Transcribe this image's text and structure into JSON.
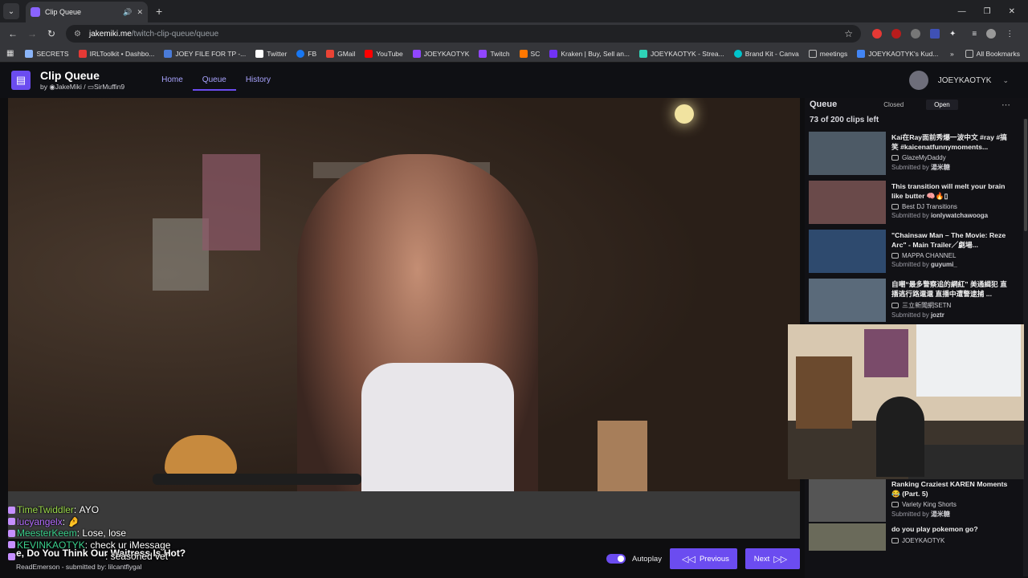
{
  "browser": {
    "tab_title": "Clip Queue",
    "url_host": "jakemiki.me",
    "url_path": "/twitch-clip-queue/queue",
    "bookmarks": [
      {
        "label": "SECRETS",
        "color": "#8ab4f8"
      },
      {
        "label": "IRLToolkit • Dashbo...",
        "color": "#e53935"
      },
      {
        "label": "JOEY FILE FOR TP -...",
        "color": "#4a7bd8"
      },
      {
        "label": "Twitter",
        "color": "#ffffff"
      },
      {
        "label": "FB",
        "color": "#1877f2"
      },
      {
        "label": "GMail",
        "color": "#ea4335"
      },
      {
        "label": "YouTube",
        "color": "#ff0000"
      },
      {
        "label": "JOEYKAOTYK",
        "color": "#9146ff"
      },
      {
        "label": "Twitch",
        "color": "#9146ff"
      },
      {
        "label": "SC",
        "color": "#ff7700"
      },
      {
        "label": "Kraken | Buy, Sell an...",
        "color": "#7132f5"
      },
      {
        "label": "JOEYKAOTYK - Strea...",
        "color": "#2ed3b7"
      },
      {
        "label": "Brand Kit - Canva",
        "color": "#00c4cc"
      },
      {
        "label": "meetings",
        "color": "#bdbdbd"
      },
      {
        "label": "JOEYKAOTYK's Kud...",
        "color": "#4285f4"
      }
    ],
    "all_bookmarks": "All Bookmarks"
  },
  "app": {
    "title": "Clip Queue",
    "by_prefix": "by",
    "author1": "JakeMiki",
    "separator": "/",
    "author2": "SirMuffin9",
    "nav": [
      "Home",
      "Queue",
      "History"
    ],
    "active_nav": "Queue",
    "username": "JOEYKAOTYK",
    "accent": "#6b4cf0"
  },
  "player": {
    "clip_title": "...e, Do You Think Our Waitress Is Hot?",
    "clip_subtitle": "ReadEmerson - submitted by: lilcantflygal",
    "autoplay_label": "Autoplay",
    "autoplay_on": true,
    "prev_label": "Previous",
    "next_label": "Next"
  },
  "chat": [
    {
      "user": "TimeTwiddler",
      "sep": ":",
      "message": "AYO"
    },
    {
      "user": "lucyangelx",
      "sep": ":",
      "message": "🤌"
    },
    {
      "user": "MeesterKeem",
      "sep": ":",
      "message": "Lose, lose"
    },
    {
      "user": "KEVINKAOTYK",
      "sep": ":",
      "message": "check ur iMessage"
    },
    {
      "user": "",
      "sep": "",
      "message": ": seasoned vet"
    }
  ],
  "queue": {
    "title": "Queue",
    "closed_label": "Closed",
    "open_label": "Open",
    "count_text": "73 of 200 clips left",
    "submitted_by": "Submitted by",
    "items": [
      {
        "title": "Kai在Ray面前秀爆一波中文 #ray #搞笑 #kaicenatfunnymoments...",
        "channel": "GlazeMyDaddy",
        "submitter": "湯米糖",
        "thumb": "#4d5a66"
      },
      {
        "title": "This transition will melt your brain like butter 🧠🔥▯",
        "channel": "Best DJ Transitions",
        "submitter": "ionlywatchawooga",
        "thumb": "#6a4a4a"
      },
      {
        "title": "\"Chainsaw Man – The Movie: Reze Arc\" - Main Trailer／劇場...",
        "channel": "MAPPA CHANNEL",
        "submitter": "guyumi_",
        "thumb": "#2e4a6e"
      },
      {
        "title": "自嘲“最多警察追的網紅” 美通緝犯 直播逃行路還還 直播中遭警逮捕 ...",
        "channel": "三立新聞網SETN",
        "submitter": "joztr",
        "thumb": "#5a6a7a"
      },
      {
        "title": "Ranking Craziest KAREN Moments😂 (Part. 5)",
        "channel": "Variety King Shorts",
        "submitter": "湯米糖",
        "thumb": "#555"
      },
      {
        "title": "do you play pokemon go?",
        "channel": "JOEYKAOTYK",
        "submitter": "",
        "thumb": "#6a6a5a"
      }
    ]
  }
}
